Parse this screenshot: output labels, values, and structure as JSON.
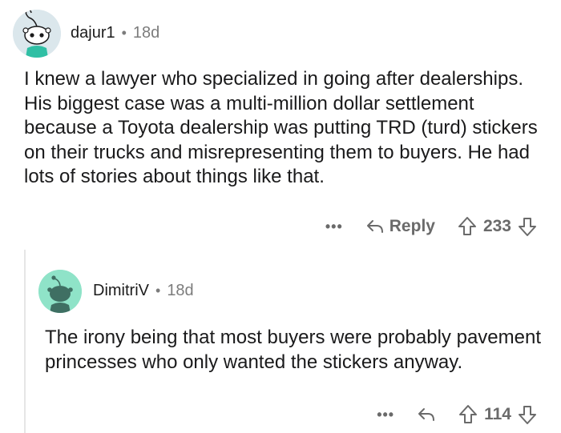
{
  "comments": [
    {
      "username": "dajur1",
      "separator": "•",
      "age": "18d",
      "text": "I knew a lawyer who specialized in going after dealerships. His biggest case was a multi-million dollar settlement because a Toyota dealership was putting TRD (turd) stickers on their trucks and misrepresenting them to buyers. He had lots of stories about things like that.",
      "more_label": "•••",
      "reply_label": "Reply",
      "upvotes": "233"
    },
    {
      "username": "DimitriV",
      "separator": "•",
      "age": "18d",
      "text": "The irony being that most buyers were probably pavement princesses who only wanted the stickers anyway.",
      "more_label": "•••",
      "upvotes": "114"
    }
  ],
  "icons": {
    "reply": "reply-arrow-icon",
    "upvote": "upvote-arrow-icon",
    "downvote": "downvote-arrow-icon",
    "more": "more-dots-icon"
  },
  "colors": {
    "text": "#1a1a1b",
    "meta": "#7c7c7c",
    "action": "#6a6a6a",
    "avatar1_bg": "#dbe7ec",
    "avatar2_bg": "#8fe3c8"
  }
}
